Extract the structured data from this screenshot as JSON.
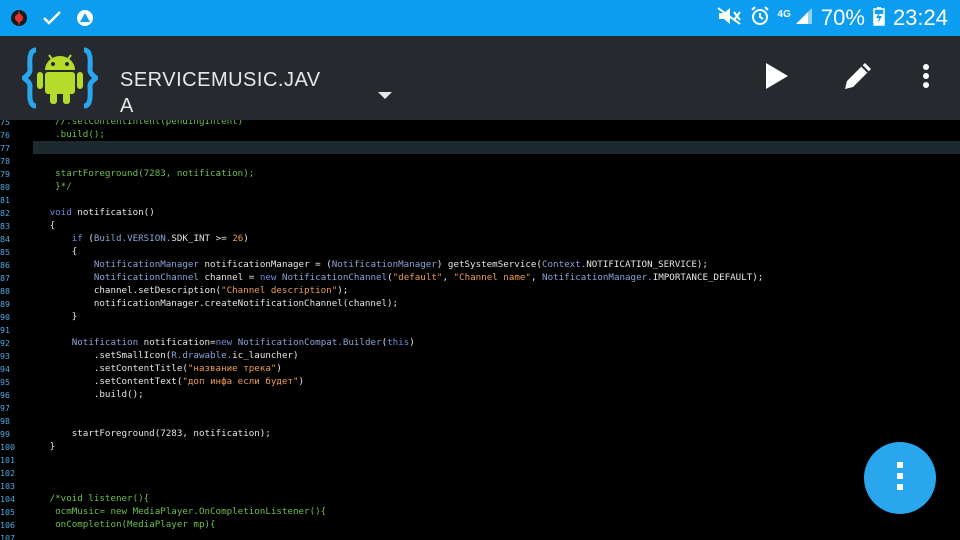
{
  "status_bar": {
    "battery_percent": "70%",
    "time": "23:24",
    "network": "4G",
    "icons": [
      "app-notification-icon",
      "check-icon",
      "drive-icon",
      "mute-icon",
      "alarm-icon",
      "signal-icon",
      "battery-charging-icon"
    ],
    "color": "#0d9df0"
  },
  "toolbar": {
    "file_name": "SERVICEMUSIC.JAVA",
    "icons": [
      "android-logo",
      "dropdown-arrow-icon",
      "run-icon",
      "edit-icon",
      "more-vert-icon"
    ],
    "background": "#262a2e"
  },
  "editor": {
    "highlighted_line": "77",
    "lines": [
      {
        "num": "75",
        "segs": [
          {
            "t": "    //.setContentIntent(pendingIntent)",
            "k": "c"
          }
        ]
      },
      {
        "num": "76",
        "segs": [
          {
            "t": "    .build();",
            "k": "c"
          }
        ]
      },
      {
        "num": "77",
        "segs": []
      },
      {
        "num": "78",
        "segs": []
      },
      {
        "num": "79",
        "segs": [
          {
            "t": "    startForeground(7283, notification);",
            "k": "c"
          }
        ]
      },
      {
        "num": "80",
        "segs": [
          {
            "t": "    }*/",
            "k": "c"
          }
        ]
      },
      {
        "num": "81",
        "segs": []
      },
      {
        "num": "82",
        "segs": [
          {
            "t": "   ",
            "k": "nm"
          },
          {
            "t": "void",
            "k": "kw"
          },
          {
            "t": " notification()",
            "k": "nm"
          }
        ]
      },
      {
        "num": "83",
        "segs": [
          {
            "t": "   {",
            "k": "nm"
          }
        ]
      },
      {
        "num": "84",
        "segs": [
          {
            "t": "       ",
            "k": "nm"
          },
          {
            "t": "if",
            "k": "kw"
          },
          {
            "t": " (",
            "k": "nm"
          },
          {
            "t": "Build.VERSION.",
            "k": "ty"
          },
          {
            "t": "SDK_INT >= ",
            "k": "nm"
          },
          {
            "t": "26",
            "k": "st"
          },
          {
            "t": ")",
            "k": "nm"
          }
        ]
      },
      {
        "num": "85",
        "segs": [
          {
            "t": "       {",
            "k": "nm"
          }
        ]
      },
      {
        "num": "86",
        "segs": [
          {
            "t": "           ",
            "k": "nm"
          },
          {
            "t": "NotificationManager",
            "k": "ty"
          },
          {
            "t": " notificationManager = (",
            "k": "nm"
          },
          {
            "t": "NotificationManager",
            "k": "ty"
          },
          {
            "t": ") getSystemService(",
            "k": "nm"
          },
          {
            "t": "Context.",
            "k": "ty"
          },
          {
            "t": "NOTIFICATION_SERVICE);",
            "k": "nm"
          }
        ]
      },
      {
        "num": "87",
        "segs": [
          {
            "t": "           ",
            "k": "nm"
          },
          {
            "t": "NotificationChannel",
            "k": "ty"
          },
          {
            "t": " channel = ",
            "k": "nm"
          },
          {
            "t": "new",
            "k": "kw"
          },
          {
            "t": " ",
            "k": "nm"
          },
          {
            "t": "NotificationChannel",
            "k": "ty"
          },
          {
            "t": "(",
            "k": "nm"
          },
          {
            "t": "\"default\"",
            "k": "st"
          },
          {
            "t": ", ",
            "k": "nm"
          },
          {
            "t": "\"Channel name\"",
            "k": "st"
          },
          {
            "t": ", ",
            "k": "nm"
          },
          {
            "t": "NotificationManager.",
            "k": "ty"
          },
          {
            "t": "IMPORTANCE_DEFAULT);",
            "k": "nm"
          }
        ]
      },
      {
        "num": "88",
        "segs": [
          {
            "t": "           channel.setDescription(",
            "k": "nm"
          },
          {
            "t": "\"Channel description\"",
            "k": "st"
          },
          {
            "t": ");",
            "k": "nm"
          }
        ]
      },
      {
        "num": "89",
        "segs": [
          {
            "t": "           notificationManager.createNotificationChannel(channel);",
            "k": "nm"
          }
        ]
      },
      {
        "num": "90",
        "segs": [
          {
            "t": "       }",
            "k": "nm"
          }
        ]
      },
      {
        "num": "91",
        "segs": []
      },
      {
        "num": "92",
        "segs": [
          {
            "t": "       ",
            "k": "nm"
          },
          {
            "t": "Notification",
            "k": "ty"
          },
          {
            "t": " notification=",
            "k": "nm"
          },
          {
            "t": "new",
            "k": "kw"
          },
          {
            "t": " ",
            "k": "nm"
          },
          {
            "t": "NotificationCompat.Builder",
            "k": "ty"
          },
          {
            "t": "(",
            "k": "nm"
          },
          {
            "t": "this",
            "k": "kw"
          },
          {
            "t": ")",
            "k": "nm"
          }
        ]
      },
      {
        "num": "93",
        "segs": [
          {
            "t": "           .setSmallIcon(",
            "k": "nm"
          },
          {
            "t": "R.drawable.",
            "k": "ty"
          },
          {
            "t": "ic_launcher)",
            "k": "nm"
          }
        ]
      },
      {
        "num": "94",
        "segs": [
          {
            "t": "           .setContentTitle(",
            "k": "nm"
          },
          {
            "t": "\"название трека\"",
            "k": "st"
          },
          {
            "t": ")",
            "k": "nm"
          }
        ]
      },
      {
        "num": "95",
        "segs": [
          {
            "t": "           .setContentText(",
            "k": "nm"
          },
          {
            "t": "\"доп инфа если будет\"",
            "k": "st"
          },
          {
            "t": ")",
            "k": "nm"
          }
        ]
      },
      {
        "num": "96",
        "segs": [
          {
            "t": "           .build();",
            "k": "nm"
          }
        ]
      },
      {
        "num": "97",
        "segs": []
      },
      {
        "num": "98",
        "segs": []
      },
      {
        "num": "99",
        "segs": [
          {
            "t": "       startForeground(7283, notification);",
            "k": "nm"
          }
        ]
      },
      {
        "num": "100",
        "segs": [
          {
            "t": "   }",
            "k": "nm"
          }
        ]
      },
      {
        "num": "101",
        "segs": []
      },
      {
        "num": "102",
        "segs": []
      },
      {
        "num": "103",
        "segs": []
      },
      {
        "num": "104",
        "segs": [
          {
            "t": "   /*void listener(){",
            "k": "c"
          }
        ]
      },
      {
        "num": "105",
        "segs": [
          {
            "t": "    ocmMusic= new MediaPlayer.OnCompletionListener(){",
            "k": "c"
          }
        ]
      },
      {
        "num": "106",
        "segs": [
          {
            "t": "    onCompletion(MediaPlayer mp){",
            "k": "c"
          }
        ]
      },
      {
        "num": "107",
        "segs": []
      }
    ]
  },
  "fab": {
    "icon": "more-vert-icon",
    "color": "#29a7ee"
  }
}
